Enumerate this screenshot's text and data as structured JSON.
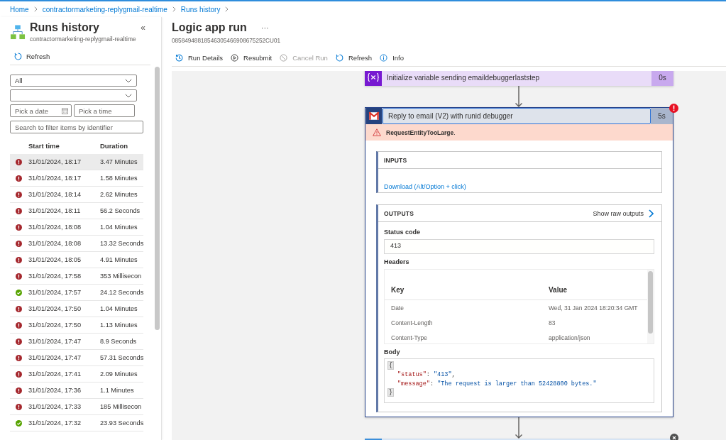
{
  "breadcrumb": [
    {
      "label": "Home"
    },
    {
      "label": "contractormarketing-replygmail-realtime"
    },
    {
      "label": "Runs history"
    }
  ],
  "runs_panel": {
    "title": "Runs history",
    "subtitle": "contractormarketing-replygmail-realtime",
    "collapse": "«",
    "refresh": "Refresh",
    "filters": [
      {
        "kind": "dropdown",
        "value": "All"
      },
      {
        "kind": "dropdown"
      },
      {
        "kind": "date",
        "placeholder": "Pick a date"
      },
      {
        "kind": "time",
        "placeholder": "Pick a time"
      },
      {
        "kind": "search",
        "placeholder": "Search to filter items by identifier"
      }
    ],
    "table": {
      "columns": [
        "Start time",
        "Duration"
      ],
      "rows": [
        {
          "failed": true,
          "start": "31/01/2024, 18:17",
          "duration": "3.47 Minutes",
          "selected": true
        },
        {
          "failed": true,
          "start": "31/01/2024, 18:17",
          "duration": "1.58 Minutes",
          "selected": false
        },
        {
          "failed": true,
          "start": "31/01/2024, 18:14",
          "duration": "2.62 Minutes",
          "selected": false
        },
        {
          "failed": true,
          "start": "31/01/2024, 18:11",
          "duration": "56.2 Seconds",
          "selected": false
        },
        {
          "failed": true,
          "start": "31/01/2024, 18:08",
          "duration": "1.04 Minutes",
          "selected": false
        },
        {
          "failed": true,
          "start": "31/01/2024, 18:08",
          "duration": "13.32 Seconds",
          "selected": false
        },
        {
          "failed": true,
          "start": "31/01/2024, 18:05",
          "duration": "4.91 Minutes",
          "selected": false
        },
        {
          "failed": true,
          "start": "31/01/2024, 17:58",
          "duration": "353 Millisecon",
          "selected": false
        },
        {
          "failed": false,
          "start": "31/01/2024, 17:57",
          "duration": "24.12 Seconds",
          "selected": false
        },
        {
          "failed": true,
          "start": "31/01/2024, 17:50",
          "duration": "1.04 Minutes",
          "selected": false
        },
        {
          "failed": true,
          "start": "31/01/2024, 17:50",
          "duration": "1.13 Minutes",
          "selected": false
        },
        {
          "failed": true,
          "start": "31/01/2024, 17:47",
          "duration": "8.9 Seconds",
          "selected": false
        },
        {
          "failed": true,
          "start": "31/01/2024, 17:47",
          "duration": "57.31 Seconds",
          "selected": false
        },
        {
          "failed": true,
          "start": "31/01/2024, 17:41",
          "duration": "2.09 Minutes",
          "selected": false
        },
        {
          "failed": true,
          "start": "31/01/2024, 17:36",
          "duration": "1.1 Minutes",
          "selected": false
        },
        {
          "failed": true,
          "start": "31/01/2024, 17:33",
          "duration": "185 Millisecon",
          "selected": false
        },
        {
          "failed": false,
          "start": "31/01/2024, 17:32",
          "duration": "23.93 Seconds",
          "selected": false
        }
      ]
    }
  },
  "run": {
    "title": "Logic app run",
    "more": "···",
    "id": "08584948818546305466908675252CU01",
    "toolbar": [
      {
        "label": "Run Details",
        "disabled": false
      },
      {
        "label": "Resubmit",
        "disabled": false
      },
      {
        "label": "Cancel Run",
        "disabled": true
      },
      {
        "label": "Refresh",
        "disabled": false
      },
      {
        "label": "Info",
        "disabled": false
      }
    ],
    "steps": [
      {
        "kind": "variable",
        "title": "Initialize variable sending emaildebuggerlaststep",
        "duration": "0s",
        "failed": false,
        "skipped": false,
        "expanded": false
      },
      {
        "kind": "email",
        "title": "Reply to email (V2) with runid debugger",
        "duration": "5s",
        "failed": true,
        "skipped": false,
        "expanded": true,
        "error": "**RequestEntityTooLarge**.",
        "inputs": {
          "title": "INPUTS",
          "link": "Download (Alt/Option + click)"
        },
        "outputs": {
          "title": "OUTPUTS",
          "raw_link": "Show raw outputs",
          "status_code": {
            "label": "Status code",
            "value": "413"
          },
          "headers": {
            "label": "Headers",
            "columns": [
              "Key",
              "Value"
            ],
            "rows": [
              {
                "key": "Date",
                "value": "Wed, 31 Jan 2024 18:20:34 GMT"
              },
              {
                "key": "Content-Length",
                "value": "83"
              },
              {
                "key": "Content-Type",
                "value": "application/json"
              }
            ]
          },
          "body": {
            "label": "Body",
            "lines": [
              [
                {
                  "kind": "brace",
                  "text": "{"
                }
              ],
              [
                {
                  "kind": "key",
                  "text": "\"status\""
                },
                {
                  "kind": "punct",
                  "text": ": "
                },
                {
                  "kind": "string",
                  "text": "\"413\""
                },
                {
                  "kind": "punct",
                  "text": ","
                }
              ],
              [
                {
                  "kind": "key",
                  "text": "\"message\""
                },
                {
                  "kind": "punct",
                  "text": ": "
                },
                {
                  "kind": "string",
                  "text": "\"The request is larger than 52428800 bytes.\""
                }
              ],
              [
                {
                  "kind": "brace",
                  "text": "}"
                }
              ]
            ]
          }
        }
      },
      {
        "kind": "action",
        "failed": false,
        "skipped": true,
        "expanded": false
      }
    ]
  }
}
